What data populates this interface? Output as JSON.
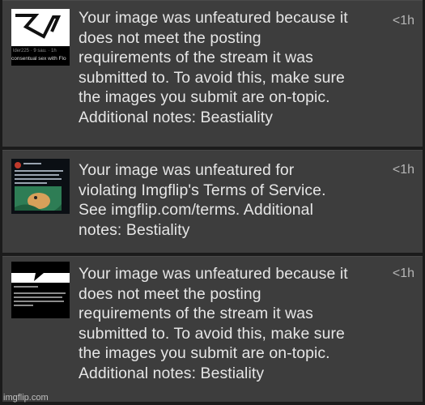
{
  "notifications": [
    {
      "thumb_caption1": "lder225 · 9 sau. · 1h",
      "thumb_caption2": "consentual sex with Flo",
      "message_lines": [
        "Your image was unfeatured because it",
        "does not meet the posting",
        "requirements of the stream it was",
        "submitted to. To avoid this, make sure",
        "the images you submit are on-topic.",
        "Additional notes: Beastiality"
      ],
      "time": "<1h"
    },
    {
      "message_lines": [
        "Your image was unfeatured for",
        "violating Imgflip's Terms of Service.",
        "See imgflip.com/terms. Additional",
        "notes: Bestiality"
      ],
      "time": "<1h"
    },
    {
      "message_lines": [
        "Your image was unfeatured because it",
        "does not meet the posting",
        "requirements of the stream it was",
        "submitted to. To avoid this, make sure",
        "the images you submit are on-topic.",
        "Additional notes: Bestiality"
      ],
      "time": "<1h"
    }
  ],
  "watermark": "imgflip.com",
  "colors": {
    "row_bg": "#3d3d3d",
    "page_bg": "#1b1b1b",
    "text": "#e6e6e6",
    "time": "#b5b5b5"
  }
}
